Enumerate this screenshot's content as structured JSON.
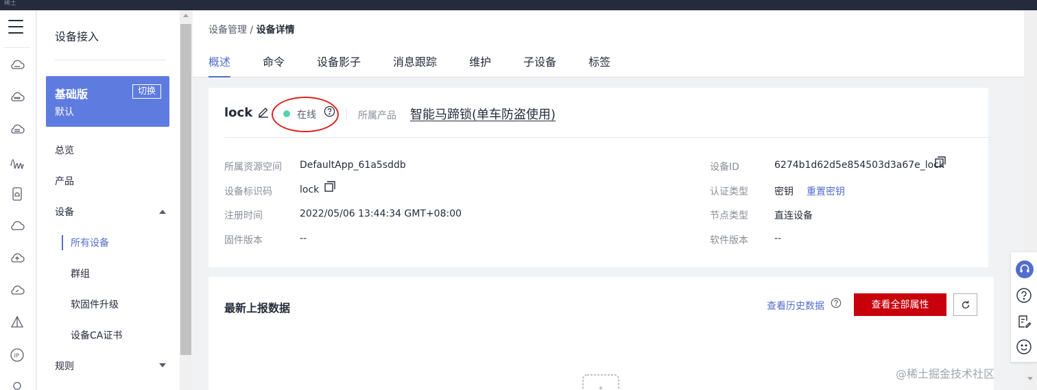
{
  "topbar": {
    "title": "稀土"
  },
  "sidebar": {
    "title": "设备接入",
    "edition": {
      "name": "基础版",
      "sub": "默认",
      "switch_label": "切换"
    },
    "items": [
      {
        "label": "总览"
      },
      {
        "label": "产品"
      },
      {
        "label": "设备"
      },
      {
        "label": "所有设备"
      },
      {
        "label": "群组"
      },
      {
        "label": "软固件升级"
      },
      {
        "label": "设备CA证书"
      },
      {
        "label": "规则"
      }
    ]
  },
  "breadcrumb": {
    "parent": "设备管理",
    "separator": " / ",
    "current": "设备详情"
  },
  "tabs": [
    "概述",
    "命令",
    "设备影子",
    "消息跟踪",
    "维护",
    "子设备",
    "标签"
  ],
  "device": {
    "name": "lock",
    "status": "在线",
    "status_color": "#50d4ab",
    "product_label": "所属产品",
    "product": "智能马蹄锁(单车防盗使用)"
  },
  "fields": {
    "space_label": "所属资源空间",
    "space": "DefaultApp_61a5sddb",
    "identifier_label": "设备标识码",
    "identifier": "lock",
    "reg_label": "注册时间",
    "reg": "2022/05/06 13:44:34 GMT+08:00",
    "fw_label": "固件版本",
    "fw": "--",
    "id_label": "设备ID",
    "id": "6274b1d62d5e854503d3a67e_lock",
    "auth_label": "认证类型",
    "auth": "密钥",
    "reset_label": "重置密钥",
    "node_label": "节点类型",
    "node": "直连设备",
    "sw_label": "软件版本",
    "sw": "--"
  },
  "reported": {
    "title": "最新上报数据",
    "history_label": "查看历史数据",
    "view_all_label": "查看全部属性"
  },
  "watermark": "@稀土掘金技术社区",
  "colors": {
    "primary": "#526ecc",
    "danger": "#c7000b",
    "edition_bg": "#5e7ce0",
    "annotation": "#e02020"
  }
}
